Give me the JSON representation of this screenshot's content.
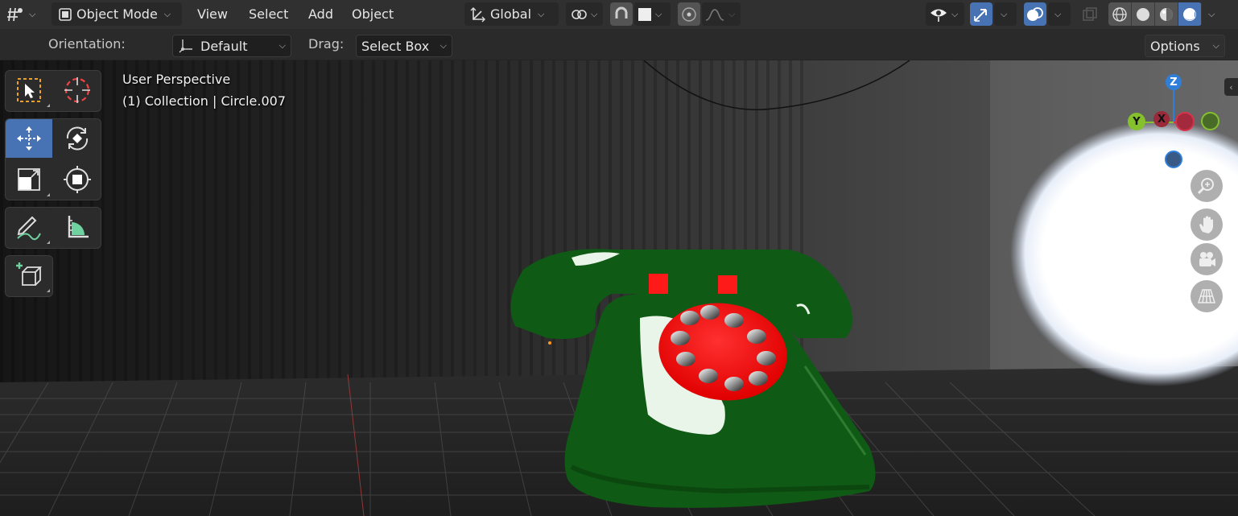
{
  "header": {
    "editor_type_icon": "grid-editor-icon",
    "mode": {
      "icon": "object-mode-icon",
      "label": "Object Mode"
    },
    "menus": [
      "View",
      "Select",
      "Add",
      "Object"
    ],
    "transform_orientation": {
      "icon": "orientation-icon",
      "label": "Global"
    },
    "pivot_icon": "pivot-point-icon",
    "snap_icon": "magnet-icon",
    "snap_target_icon": "snap-increment-icon",
    "proportional_icon": "proportional-edit-icon",
    "falloff_icon": "falloff-curve-icon",
    "visibility_icon": "eye-icon",
    "gizmo_icon": "gizmo-icon",
    "overlay_icon": "overlay-icon",
    "xray_icon": "xray-icon",
    "shading_modes": [
      "wireframe-icon",
      "solid-icon",
      "material-preview-icon",
      "rendered-icon"
    ],
    "active_shading": "rendered"
  },
  "tool_header": {
    "orientation_label": "Orientation:",
    "orientation_value": "Default",
    "drag_label": "Drag:",
    "drag_value": "Select Box",
    "options_label": "Options"
  },
  "viewport": {
    "view_name": "User Perspective",
    "collection_info": "(1) Collection | Circle.007",
    "axes": {
      "z": "Z",
      "y": "Y",
      "x": "X"
    },
    "nav_buttons": [
      "zoom-icon",
      "hand-pan-icon",
      "camera-icon",
      "perspective-grid-icon"
    ]
  },
  "toolbar": {
    "tools": [
      "select-box",
      "cursor",
      "move",
      "rotate",
      "scale",
      "transform",
      "annotate",
      "measure",
      "add-cube"
    ],
    "active_tool": "move"
  },
  "colors": {
    "accent": "#4772b3",
    "header_bg": "#303030",
    "phone_green": "#0f5a14",
    "phone_red": "#ff1a1a",
    "axis_x": "#d7334b",
    "axis_y": "#84c12c",
    "axis_z": "#2f7fd8"
  }
}
